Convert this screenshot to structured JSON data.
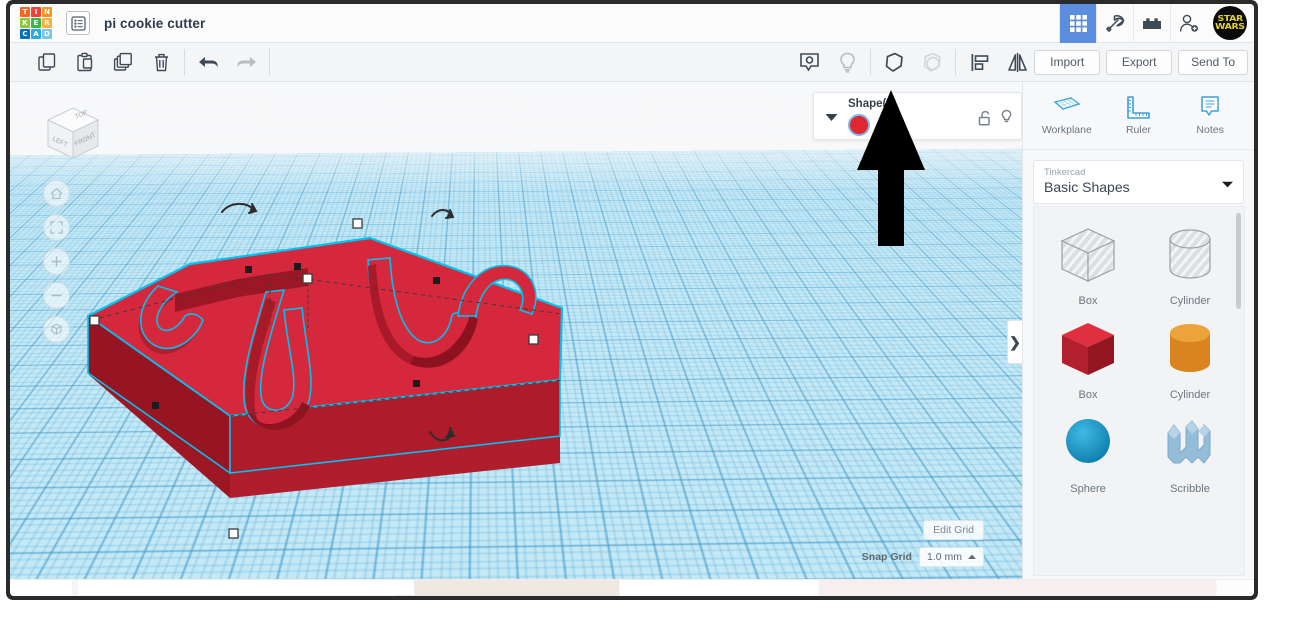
{
  "app": {
    "name": "Tinkercad",
    "logo_tiles": [
      {
        "letter": "T",
        "color": "#f26522"
      },
      {
        "letter": "I",
        "color": "#ef4136"
      },
      {
        "letter": "N",
        "color": "#f7941e"
      },
      {
        "letter": "K",
        "color": "#8dc63f"
      },
      {
        "letter": "E",
        "color": "#39b54a"
      },
      {
        "letter": "R",
        "color": "#fbb03b"
      },
      {
        "letter": "C",
        "color": "#0071bc"
      },
      {
        "letter": "A",
        "color": "#29abe2"
      },
      {
        "letter": "D",
        "color": "#7ac7e8"
      }
    ]
  },
  "header": {
    "menu_icon": "list-menu-icon",
    "document_title": "pi cookie cutter",
    "right_icons": [
      {
        "name": "grid-gallery-icon",
        "active": true
      },
      {
        "name": "pickaxe-icon",
        "active": false
      },
      {
        "name": "blocks-icon",
        "active": false
      },
      {
        "name": "add-user-icon",
        "active": false
      }
    ],
    "avatar": {
      "name": "star-wars-avatar",
      "line1": "STAR",
      "line2": "WARS",
      "bg": "#0a0a0a",
      "fg": "#e6d22a"
    }
  },
  "toolbar": {
    "left_tools": [
      {
        "name": "copy-icon",
        "dim": false
      },
      {
        "name": "paste-icon",
        "dim": false
      },
      {
        "name": "duplicate-icon",
        "dim": false
      },
      {
        "name": "delete-icon",
        "dim": false
      },
      {
        "name": "undo-icon",
        "dim": false
      },
      {
        "name": "redo-icon",
        "dim": true
      }
    ],
    "mid_tools": [
      {
        "name": "note-icon",
        "dim": false
      },
      {
        "name": "lightbulb-icon",
        "dim": true
      },
      {
        "name": "solid-shape-icon",
        "dim": false
      },
      {
        "name": "hole-shape-icon",
        "dim": true
      },
      {
        "name": "align-icon",
        "dim": false
      },
      {
        "name": "mirror-icon",
        "dim": false
      }
    ],
    "buttons": [
      {
        "label": "Import"
      },
      {
        "label": "Export"
      },
      {
        "label": "Send To"
      }
    ]
  },
  "canvas": {
    "view_cube": {
      "top": "TOP",
      "left": "LEFT",
      "front": "FRONT"
    },
    "nav_buttons": [
      {
        "name": "home-view-button"
      },
      {
        "name": "fit-to-view-button"
      },
      {
        "name": "zoom-in-button"
      },
      {
        "name": "zoom-out-button"
      },
      {
        "name": "perspective-toggle-button"
      }
    ],
    "shape_panel": {
      "title": "Shape(2)",
      "color": "#e0262e",
      "actions": [
        {
          "name": "unlock-icon"
        },
        {
          "name": "lightbulb-icon"
        }
      ]
    },
    "edit_grid_label": "Edit Grid",
    "snap_grid_label": "Snap Grid",
    "snap_grid_value": "1.0 mm",
    "panel_toggle_glyph": "❯",
    "workplane_color": "#c5e8f5",
    "model": {
      "name": "pi-cookie-cutter-model",
      "body_color": "#d6283c",
      "selection_color": "#00c2f0"
    }
  },
  "right_panel": {
    "tools": [
      {
        "label": "Workplane",
        "icon": "workplane-icon"
      },
      {
        "label": "Ruler",
        "icon": "ruler-icon"
      },
      {
        "label": "Notes",
        "icon": "notes-icon"
      }
    ],
    "category": {
      "group": "Tinkercad",
      "selected": "Basic Shapes"
    },
    "shapes": [
      {
        "label": "Box",
        "kind": "hole-box"
      },
      {
        "label": "Cylinder",
        "kind": "hole-cylinder"
      },
      {
        "label": "Box",
        "kind": "solid-box",
        "color": "#c8202e"
      },
      {
        "label": "Cylinder",
        "kind": "solid-cylinder",
        "color": "#e08b28"
      },
      {
        "label": "Sphere",
        "kind": "solid-sphere",
        "color": "#1b9fd4"
      },
      {
        "label": "Scribble",
        "kind": "scribble",
        "color": "#93bdd9"
      }
    ]
  }
}
